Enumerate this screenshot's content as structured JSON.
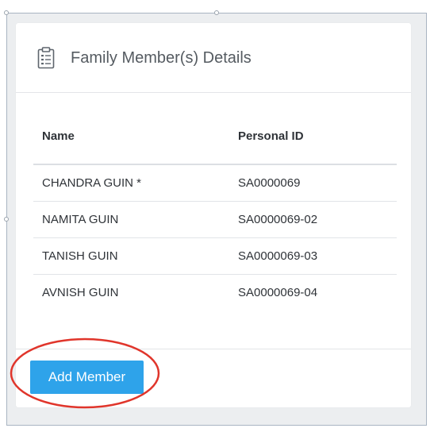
{
  "panel": {
    "title": "Family Member(s) Details",
    "icon": "clipboard-list-icon"
  },
  "table": {
    "columns": [
      "Name",
      "Personal ID"
    ],
    "rows": [
      {
        "name": "CHANDRA GUIN *",
        "personal_id": "SA0000069"
      },
      {
        "name": "NAMITA GUIN",
        "personal_id": "SA0000069-02"
      },
      {
        "name": "TANISH GUIN",
        "personal_id": "SA0000069-03"
      },
      {
        "name": "AVNISH GUIN",
        "personal_id": "SA0000069-04"
      }
    ]
  },
  "actions": {
    "add_member_label": "Add Member"
  },
  "colors": {
    "accent": "#2ea3ea",
    "annotation": "#e0352b",
    "background": "#eceef0"
  }
}
